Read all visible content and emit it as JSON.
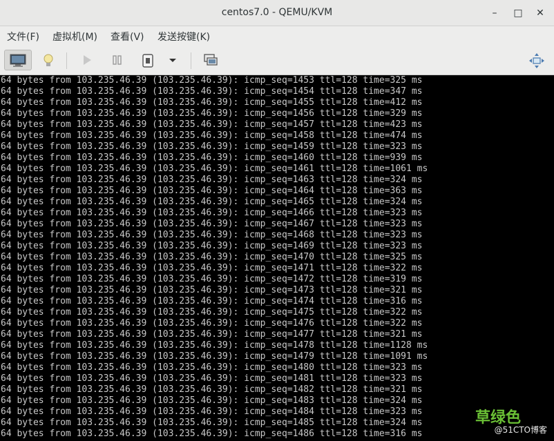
{
  "window": {
    "title": "centos7.0 - QEMU/KVM",
    "minimize": "–",
    "maximize": "□",
    "close": "✕"
  },
  "menu": [
    "文件(F)",
    "虚拟机(M)",
    "查看(V)",
    "发送按键(K)"
  ],
  "toolbar": {
    "icons": [
      "console-icon",
      "details-lightbulb-icon",
      "run-icon",
      "pause-icon",
      "shutdown-icon",
      "shutdown-menu-icon",
      "snapshots-icon",
      "fullscreen-icon"
    ]
  },
  "console": {
    "lines": [
      "64 bytes from 103.235.46.39 (103.235.46.39): icmp_seq=1453 ttl=128 time=325 ms",
      "64 bytes from 103.235.46.39 (103.235.46.39): icmp_seq=1454 ttl=128 time=347 ms",
      "64 bytes from 103.235.46.39 (103.235.46.39): icmp_seq=1455 ttl=128 time=412 ms",
      "64 bytes from 103.235.46.39 (103.235.46.39): icmp_seq=1456 ttl=128 time=329 ms",
      "64 bytes from 103.235.46.39 (103.235.46.39): icmp_seq=1457 ttl=128 time=423 ms",
      "64 bytes from 103.235.46.39 (103.235.46.39): icmp_seq=1458 ttl=128 time=474 ms",
      "64 bytes from 103.235.46.39 (103.235.46.39): icmp_seq=1459 ttl=128 time=323 ms",
      "64 bytes from 103.235.46.39 (103.235.46.39): icmp_seq=1460 ttl=128 time=939 ms",
      "64 bytes from 103.235.46.39 (103.235.46.39): icmp_seq=1461 ttl=128 time=1061 ms",
      "64 bytes from 103.235.46.39 (103.235.46.39): icmp_seq=1463 ttl=128 time=324 ms",
      "64 bytes from 103.235.46.39 (103.235.46.39): icmp_seq=1464 ttl=128 time=363 ms",
      "64 bytes from 103.235.46.39 (103.235.46.39): icmp_seq=1465 ttl=128 time=324 ms",
      "64 bytes from 103.235.46.39 (103.235.46.39): icmp_seq=1466 ttl=128 time=323 ms",
      "64 bytes from 103.235.46.39 (103.235.46.39): icmp_seq=1467 ttl=128 time=323 ms",
      "64 bytes from 103.235.46.39 (103.235.46.39): icmp_seq=1468 ttl=128 time=323 ms",
      "64 bytes from 103.235.46.39 (103.235.46.39): icmp_seq=1469 ttl=128 time=323 ms",
      "64 bytes from 103.235.46.39 (103.235.46.39): icmp_seq=1470 ttl=128 time=325 ms",
      "64 bytes from 103.235.46.39 (103.235.46.39): icmp_seq=1471 ttl=128 time=322 ms",
      "64 bytes from 103.235.46.39 (103.235.46.39): icmp_seq=1472 ttl=128 time=319 ms",
      "64 bytes from 103.235.46.39 (103.235.46.39): icmp_seq=1473 ttl=128 time=321 ms",
      "64 bytes from 103.235.46.39 (103.235.46.39): icmp_seq=1474 ttl=128 time=316 ms",
      "64 bytes from 103.235.46.39 (103.235.46.39): icmp_seq=1475 ttl=128 time=322 ms",
      "64 bytes from 103.235.46.39 (103.235.46.39): icmp_seq=1476 ttl=128 time=322 ms",
      "64 bytes from 103.235.46.39 (103.235.46.39): icmp_seq=1477 ttl=128 time=321 ms",
      "64 bytes from 103.235.46.39 (103.235.46.39): icmp_seq=1478 ttl=128 time=1128 ms",
      "64 bytes from 103.235.46.39 (103.235.46.39): icmp_seq=1479 ttl=128 time=1091 ms",
      "64 bytes from 103.235.46.39 (103.235.46.39): icmp_seq=1480 ttl=128 time=323 ms",
      "64 bytes from 103.235.46.39 (103.235.46.39): icmp_seq=1481 ttl=128 time=323 ms",
      "64 bytes from 103.235.46.39 (103.235.46.39): icmp_seq=1482 ttl=128 time=321 ms",
      "64 bytes from 103.235.46.39 (103.235.46.39): icmp_seq=1483 ttl=128 time=324 ms",
      "64 bytes from 103.235.46.39 (103.235.46.39): icmp_seq=1484 ttl=128 time=323 ms",
      "64 bytes from 103.235.46.39 (103.235.46.39): icmp_seq=1485 ttl=128 time=324 ms",
      "64 bytes from 103.235.46.39 (103.235.46.39): icmp_seq=1486 ttl=128 time=316 ms"
    ]
  },
  "watermark": {
    "main": "草绿色",
    "sub": "@51CTO博客"
  }
}
